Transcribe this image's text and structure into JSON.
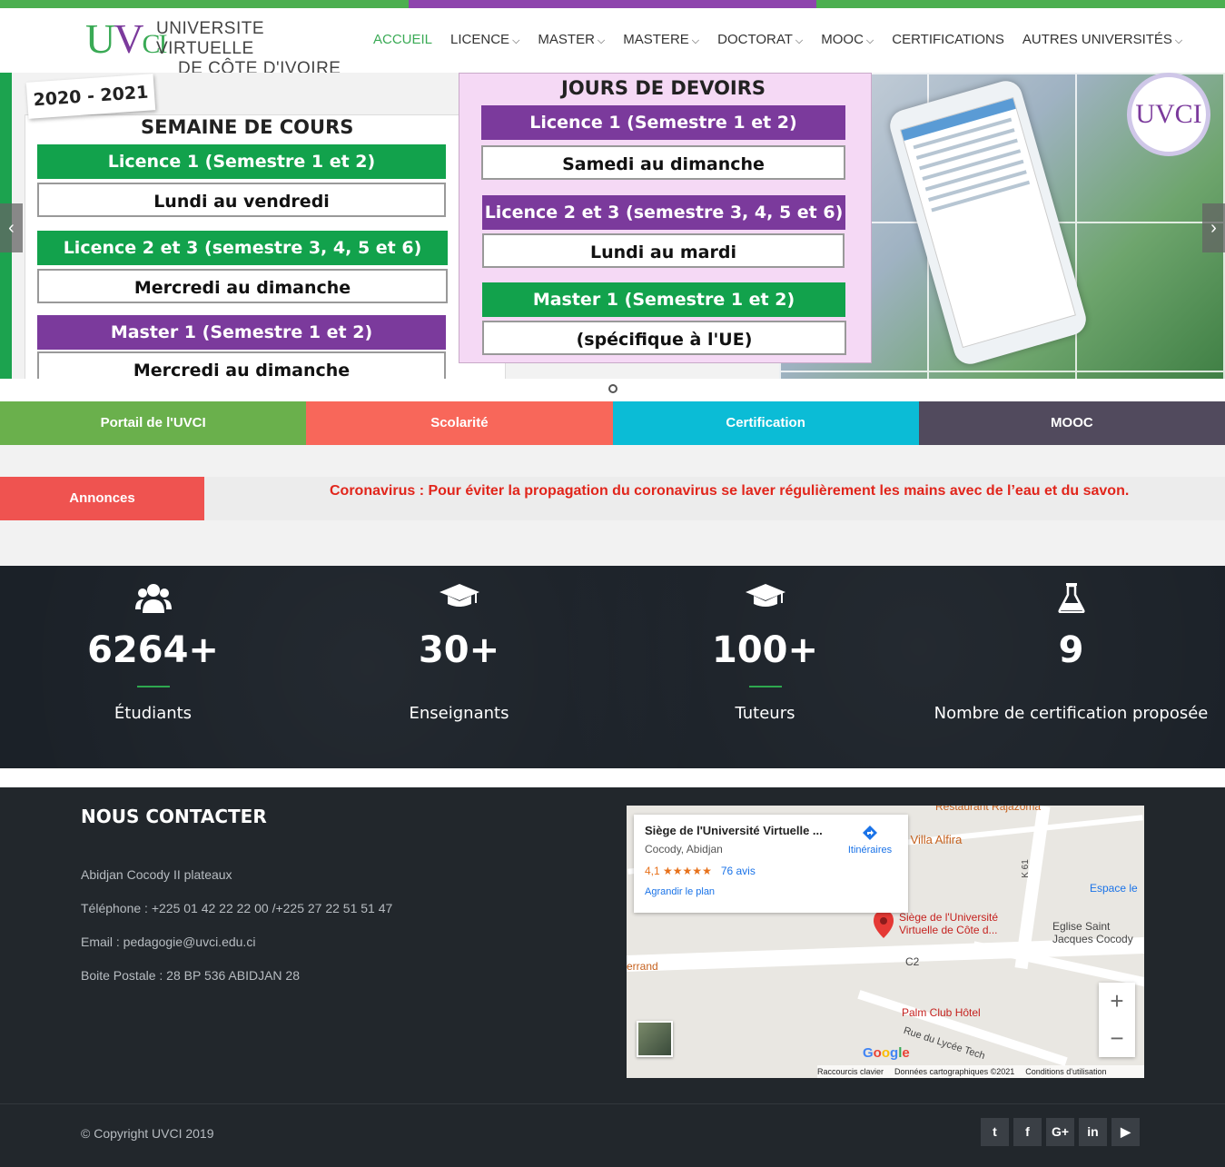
{
  "brand": {
    "mark": "UVCI",
    "line1": "UNIVERSITE VIRTUELLE",
    "line2": "DE CÔTE D'IVOIRE",
    "colors": {
      "green": "#3aaa55",
      "purple": "#7b3a9c"
    }
  },
  "topbar_colors": [
    "#4caf50",
    "#8e44ad",
    "#4caf50"
  ],
  "nav": {
    "items": [
      {
        "label": "ACCUEIL",
        "active": true,
        "dropdown": false
      },
      {
        "label": "LICENCE",
        "active": false,
        "dropdown": true
      },
      {
        "label": "MASTER",
        "active": false,
        "dropdown": true
      },
      {
        "label": "MASTERE",
        "active": false,
        "dropdown": true
      },
      {
        "label": "DOCTORAT",
        "active": false,
        "dropdown": true
      },
      {
        "label": "MOOC",
        "active": false,
        "dropdown": true
      },
      {
        "label": "CERTIFICATIONS",
        "active": false,
        "dropdown": false
      },
      {
        "label": "AUTRES UNIVERSITÉS",
        "active": false,
        "dropdown": true
      }
    ]
  },
  "slider": {
    "year": "2020 - 2021",
    "left_title": "SEMAINE DE COURS",
    "left_rows": [
      {
        "head": "Licence 1 (Semestre 1 et 2)",
        "value": "Lundi au vendredi",
        "color": "green"
      },
      {
        "head": "Licence 2 et 3 (semestre 3, 4, 5 et 6)",
        "value": "Mercredi au dimanche",
        "color": "green"
      },
      {
        "head": "Master 1 (Semestre 1 et 2)",
        "value": "Mercredi au dimanche",
        "color": "purple"
      }
    ],
    "right_title": "JOURS DE DEVOIRS",
    "right_rows": [
      {
        "head": "Licence 1 (Semestre 1 et 2)",
        "value": "Samedi au dimanche",
        "color": "purple"
      },
      {
        "head": "Licence 2 et 3 (semestre 3, 4, 5 et 6)",
        "value": "Lundi au mardi",
        "color": "purple"
      },
      {
        "head": "Master 1 (Semestre 1 et 2)",
        "value": "(spécifique à l'UE)",
        "color": "green"
      }
    ],
    "badge": "UVCI",
    "prev_icon": "chevron-left-icon",
    "next_icon": "chevron-right-icon"
  },
  "quick_links": [
    {
      "label": "Portail de l'UVCI",
      "color": "#6ab04c"
    },
    {
      "label": "Scolarité",
      "color": "#f8675a"
    },
    {
      "label": "Certification",
      "color": "#0bbcd6"
    },
    {
      "label": "MOOC",
      "color": "#514a5d"
    }
  ],
  "announcements": {
    "label": "Annonces",
    "text": "Coronavirus : Pour éviter la propagation du coronavirus se laver régulièrement les mains avec de l’eau et du savon."
  },
  "stats": [
    {
      "icon": "users-icon",
      "value": "6264",
      "suffix": "+",
      "label": "Étudiants"
    },
    {
      "icon": "graduation-cap-icon",
      "value": "30",
      "suffix": "+",
      "label": "Enseignants"
    },
    {
      "icon": "graduation-cap-icon",
      "value": "100",
      "suffix": "+",
      "label": "Tuteurs"
    },
    {
      "icon": "flask-icon",
      "value": "9",
      "suffix": "",
      "label": "Nombre de certification proposée"
    }
  ],
  "contact": {
    "title": "NOUS CONTACTER",
    "address": "Abidjan Cocody II plateaux",
    "phone": "Téléphone : +225 01 42 22 22 00 /+225 27 22 51 51 47",
    "email": "Email : pedagogie@uvci.edu.ci",
    "postal": "Boite Postale : 28 BP 536 ABIDJAN 28"
  },
  "map": {
    "place_title": "Siège de l'Université Virtuelle ...",
    "place_sub": "Cocody, Abidjan",
    "rating": "4,1",
    "stars": "★★★★★",
    "reviews": "76 avis",
    "enlarge": "Agrandir le plan",
    "directions": "Itinéraires",
    "labels": {
      "restaurant1": "Restaurant Rajazoma",
      "villa": "nt La Villa Alfira",
      "espace": "Espace le",
      "eglise": "Eglise Saint\nJacques Cocody",
      "pin_label": "Siège de l'Université\nVirtuelle de Côte d...",
      "c2": "C2",
      "k61": "K 61",
      "errand": "errand",
      "palm": "Palm Club Hôtel",
      "rue": "Rue du Lycée Tech"
    },
    "google": "Google",
    "footer": [
      "Raccourcis clavier",
      "Données cartographiques ©2021",
      "Conditions d'utilisation"
    ],
    "zoom_in": "+",
    "zoom_out": "−"
  },
  "footer": {
    "copyright": "© Copyright UVCI 2019",
    "social": [
      {
        "icon": "twitter-icon",
        "glyph": "t"
      },
      {
        "icon": "facebook-icon",
        "glyph": "f"
      },
      {
        "icon": "google-plus-icon",
        "glyph": "G+"
      },
      {
        "icon": "linkedin-icon",
        "glyph": "in"
      },
      {
        "icon": "youtube-icon",
        "glyph": "▶"
      }
    ]
  }
}
